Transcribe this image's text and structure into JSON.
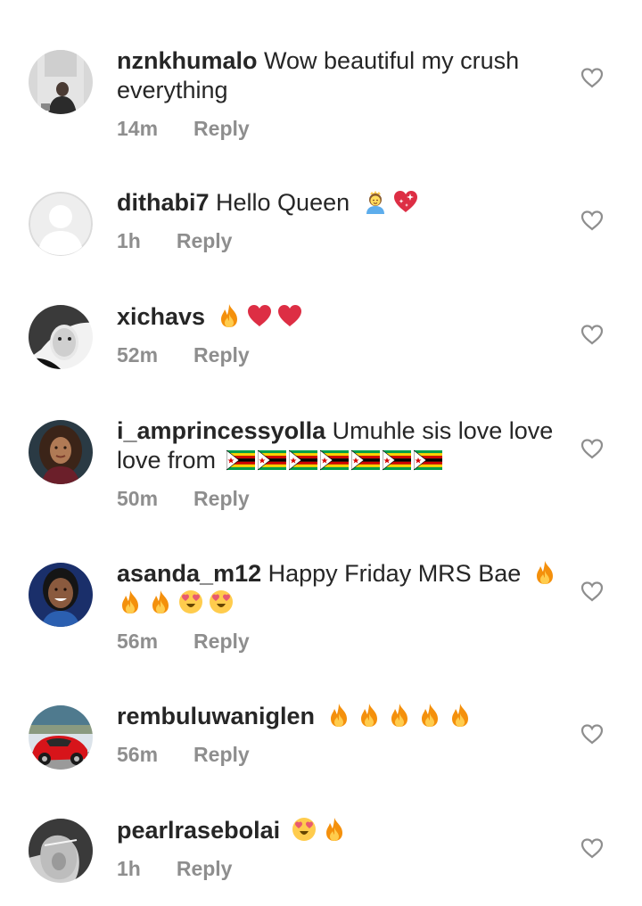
{
  "comments": [
    {
      "username": "nznkhumalo",
      "text": "Wow beautiful my crush everything",
      "time": "14m",
      "reply": "Reply",
      "avatar": "avatar-photo"
    },
    {
      "username": "dithabi7",
      "text": "Hello Queen",
      "time": "1h",
      "reply": "Reply",
      "avatar": "default-avatar"
    },
    {
      "username": "xichavs",
      "text": "",
      "time": "52m",
      "reply": "Reply",
      "avatar": "avatar-photo"
    },
    {
      "username": "i_amprincessyolla",
      "text": "Umuhle sis love love love  from",
      "time": "50m",
      "reply": "Reply",
      "avatar": "avatar-photo"
    },
    {
      "username": "asanda_m12",
      "text": "Happy Friday MRS Bae",
      "time": "56m",
      "reply": "Reply",
      "avatar": "avatar-photo"
    },
    {
      "username": "rembuluwaniglen",
      "text": "",
      "time": "56m",
      "reply": "Reply",
      "avatar": "avatar-photo"
    },
    {
      "username": "pearlrasebolai",
      "text": "",
      "time": "1h",
      "reply": "Reply",
      "avatar": "avatar-photo"
    }
  ],
  "icons": {
    "like": "heart-outline-icon",
    "fire": "fire-emoji",
    "red_heart": "red-heart-emoji",
    "sparkling_heart": "sparkling-heart-emoji",
    "princess": "princess-emoji",
    "heart_eyes": "heart-eyes-emoji",
    "flag": "zimbabwe-flag-emoji"
  },
  "colors": {
    "text": "#262626",
    "meta": "#8e8e8e",
    "heart_outline": "#8e8e8e"
  }
}
